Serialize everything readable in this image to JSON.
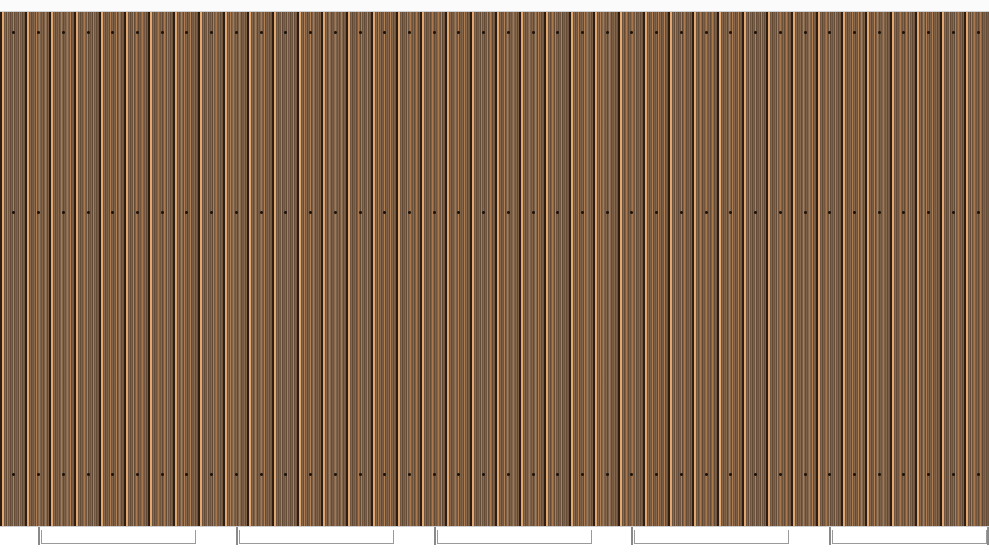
{
  "scene": {
    "subject": "wood-deck-boards",
    "board_count": 40,
    "fastener_rows": 3,
    "support_segments": 5,
    "colors": {
      "wood_base": "#7a5e45",
      "seam_dark": "#2e1d12",
      "seam_light": "#e0a870",
      "fastener": "#1b120b",
      "support_line": "#9a9a9a",
      "background": "#ffffff"
    }
  }
}
